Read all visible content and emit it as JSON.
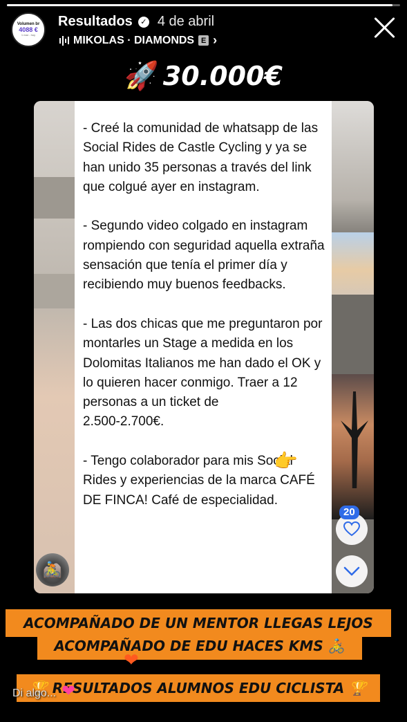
{
  "story": {
    "progress": 0.98,
    "account": {
      "avatar_line1": "Volumen br",
      "avatar_line2": "4088 €",
      "avatar_line3": "1 mar - hoy",
      "name": "Resultados",
      "verified_icon": "verified-badge-icon",
      "date": "4 de abril"
    },
    "music": {
      "icon": "sound-bars-icon",
      "track": "MIKOLAS · DIAMONDS",
      "explicit": "E",
      "arrow": "›"
    },
    "close_icon": "close-icon",
    "amount": {
      "icon": "🚀",
      "text": "30.000€"
    },
    "note": {
      "text": "- Creé la comunidad de whatsapp de las Social Rides de Castle Cycling y ya se han unido 35 personas a través del link que colgué ayer en instagram.\n\n- Segundo video colgado en instagram rompiendo con seguridad aquella extraña sensación que tenía el primer día y recibiendo muy buenos feedbacks.\n\n- Las dos chicas que me preguntaron por montarles un Stage a medida en los Dolomitas Italianos me han dado el OK y lo quieren hacer conmigo. Traer a 12 personas a un ticket de\n2.500-2.700€.\n\n- Tengo colaborador para mis Social Rides y experiencias de la marca CAFÉ DE FINCA! Café de especialidad.",
      "pointing_emoji": "👉"
    },
    "thumb_emoji": "🚵",
    "likes": {
      "count": "20",
      "heart_icon": "heart-outline-icon",
      "down_icon": "chevron-down-icon"
    },
    "banners": {
      "line1": "ACOMPAÑADO DE UN MENTOR LLEGAS LEJOS",
      "line2": "ACOMPAÑADO DE EDU HACES KMS 🚴",
      "line3": "🏆 RESULTADOS ALUMNOS EDU CICLISTA 🏆"
    },
    "floating_hearts": [
      "❤",
      "❤"
    ],
    "reply_placeholder": "Di algo...",
    "colors": {
      "banner": "#f28a1e",
      "like_badge": "#2f6be8",
      "heart_orange": "#ff5a1f",
      "heart_pink": "#ff3fa0"
    }
  }
}
